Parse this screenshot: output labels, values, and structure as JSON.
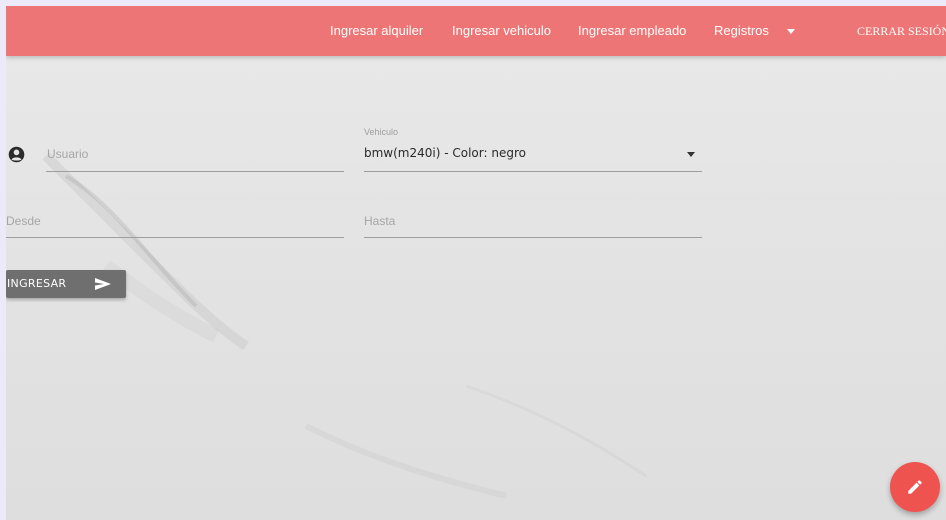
{
  "navbar": {
    "links": [
      {
        "label": "Ingresar alquiler"
      },
      {
        "label": "Ingresar vehiculo"
      },
      {
        "label": "Ingresar empleado"
      },
      {
        "label": "Registros"
      }
    ],
    "logout_label": "CERRAR SESIÓN"
  },
  "form": {
    "usuario_placeholder": "Usuario",
    "vehiculo_label": "Vehiculo",
    "vehiculo_value": "bmw(m240i) - Color: negro",
    "desde_placeholder": "Desde",
    "hasta_placeholder": "Hasta",
    "submit_label": "INGRESAR"
  },
  "icons": {
    "user": "account-circle-icon",
    "dropdown": "chevron-down-icon",
    "send": "send-icon",
    "edit": "pencil-icon"
  },
  "colors": {
    "navbar": "#ee7575",
    "button": "#6f6f6f",
    "fab": "#ef5350"
  }
}
